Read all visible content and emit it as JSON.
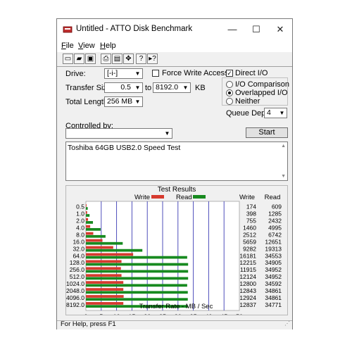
{
  "window": {
    "title": "Untitled - ATTO Disk Benchmark"
  },
  "titlebar_buttons": {
    "minimize": "—",
    "maximize": "☐",
    "close": "✕"
  },
  "menu": [
    {
      "mnemonic": "F",
      "rest": "ile"
    },
    {
      "mnemonic": "V",
      "rest": "iew"
    },
    {
      "mnemonic": "H",
      "rest": "elp"
    }
  ],
  "toolbar": {
    "icons": [
      "new-file-icon",
      "open-folder-icon",
      "save-icon",
      "print-icon",
      "print-preview-icon",
      "move-icon",
      "help-icon",
      "context-help-icon"
    ],
    "glyphs": [
      "▭",
      "▰",
      "▣",
      "⎙",
      "▤",
      "✥",
      "?",
      "▸?"
    ]
  },
  "settings": {
    "drive_label": "Drive:",
    "drive_value": "[-i-]",
    "transfer_size_label": "Transfer Size:",
    "transfer_from": "0.5",
    "to_label": "to",
    "transfer_to": "8192.0",
    "unit": "KB",
    "total_length_label": "Total Length:",
    "total_length_value": "256 MB",
    "force_write_access": "Force Write Access",
    "direct_io": "Direct I/O",
    "io_comparison": "I/O Comparison",
    "overlapped_io": "Overlapped I/O",
    "neither": "Neither",
    "queue_depth_label": "Queue Depth:",
    "queue_depth_value": "4",
    "controlled_by_label": "Controlled by:",
    "controlled_by_value": "",
    "start_button": "Start",
    "description": "Toshiba 64GB USB2.0 Speed Test"
  },
  "results": {
    "title": "Test Results",
    "legend_write": "Write",
    "legend_read": "Read",
    "col_write": "Write",
    "col_read": "Read",
    "xlabel": "Transfer Rate - MB / Sec",
    "ticks": [
      "0",
      "5",
      "10",
      "15",
      "20",
      "25",
      "30",
      "35",
      "40",
      "45",
      "50"
    ],
    "colors": {
      "write": "#d63a2e",
      "read": "#178a1f",
      "gridline": "#3c3cb4"
    }
  },
  "status": {
    "text": "For Help, press F1"
  },
  "chart_data": {
    "type": "bar",
    "title": "Test Results",
    "xlabel": "Transfer Rate - MB / Sec",
    "xlim": [
      0,
      50
    ],
    "orientation": "horizontal",
    "categories": [
      "0.5",
      "1.0",
      "2.0",
      "4.0",
      "8.0",
      "16.0",
      "32.0",
      "64.0",
      "128.0",
      "256.0",
      "512.0",
      "1024.0",
      "2048.0",
      "4096.0",
      "8192.0"
    ],
    "series": [
      {
        "name": "Write",
        "bar_values": [
          0.2,
          0.4,
          0.7,
          1.4,
          2.4,
          5.4,
          8.9,
          15.4,
          11.6,
          11.4,
          11.6,
          12.2,
          12.2,
          12.3,
          12.2
        ],
        "labels": [
          "174",
          "398",
          "755",
          "1460",
          "2512",
          "5659",
          "9282",
          "16181",
          "12215",
          "11915",
          "12124",
          "12800",
          "12843",
          "12924",
          "12837"
        ]
      },
      {
        "name": "Read",
        "bar_values": [
          0.6,
          1.2,
          2.3,
          4.8,
          6.4,
          12.0,
          18.4,
          33.0,
          33.3,
          33.3,
          33.3,
          33.0,
          33.2,
          33.2,
          33.2
        ],
        "labels": [
          "609",
          "1285",
          "2432",
          "4995",
          "6742",
          "12651",
          "19313",
          "34553",
          "34905",
          "34952",
          "34952",
          "34592",
          "34861",
          "34861",
          "34771"
        ]
      }
    ]
  }
}
